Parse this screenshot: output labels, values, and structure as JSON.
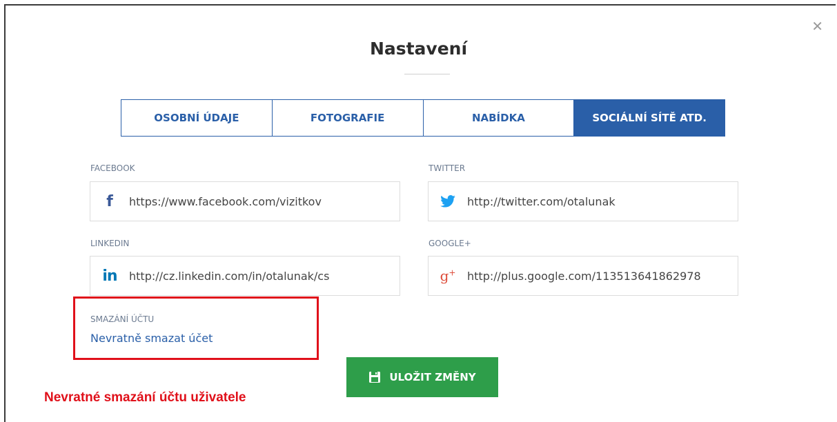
{
  "dialog": {
    "title": "Nastavení",
    "close_glyph": "✕"
  },
  "tabs": [
    {
      "label": "OSOBNÍ ÚDAJE",
      "active": false
    },
    {
      "label": "FOTOGRAFIE",
      "active": false
    },
    {
      "label": "NABÍDKA",
      "active": false
    },
    {
      "label": "SOCIÁLNÍ SÍTĚ ATD.",
      "active": true
    }
  ],
  "fields": {
    "facebook": {
      "label": "FACEBOOK",
      "value": "https://www.facebook.com/vizitkov",
      "icon": "facebook-icon",
      "glyph": "f"
    },
    "twitter": {
      "label": "TWITTER",
      "value": "http://twitter.com/otalunak",
      "icon": "twitter-icon"
    },
    "linkedin": {
      "label": "LINKEDIN",
      "value": "http://cz.linkedin.com/in/otalunak/cs",
      "icon": "linkedin-icon",
      "glyph": "in"
    },
    "google": {
      "label": "GOOGLE+",
      "value": "http://plus.google.com/113513641862978",
      "icon": "google-plus-icon",
      "glyph": "g"
    }
  },
  "account_delete": {
    "label": "SMAZÁNÍ ÚČTU",
    "link": "Nevratně smazat účet"
  },
  "save_button": {
    "label": "ULOŽIT ZMĚNY",
    "icon": "floppy-disk-icon"
  },
  "annotation": "Nevratné smazání účtu uživatele",
  "colors": {
    "primary": "#2a5fa8",
    "success": "#2e9e4a",
    "annotation_red": "#e0101a",
    "facebook": "#3b5998",
    "twitter": "#1da1f2",
    "linkedin": "#0077b5",
    "google_plus": "#dd4b39"
  }
}
